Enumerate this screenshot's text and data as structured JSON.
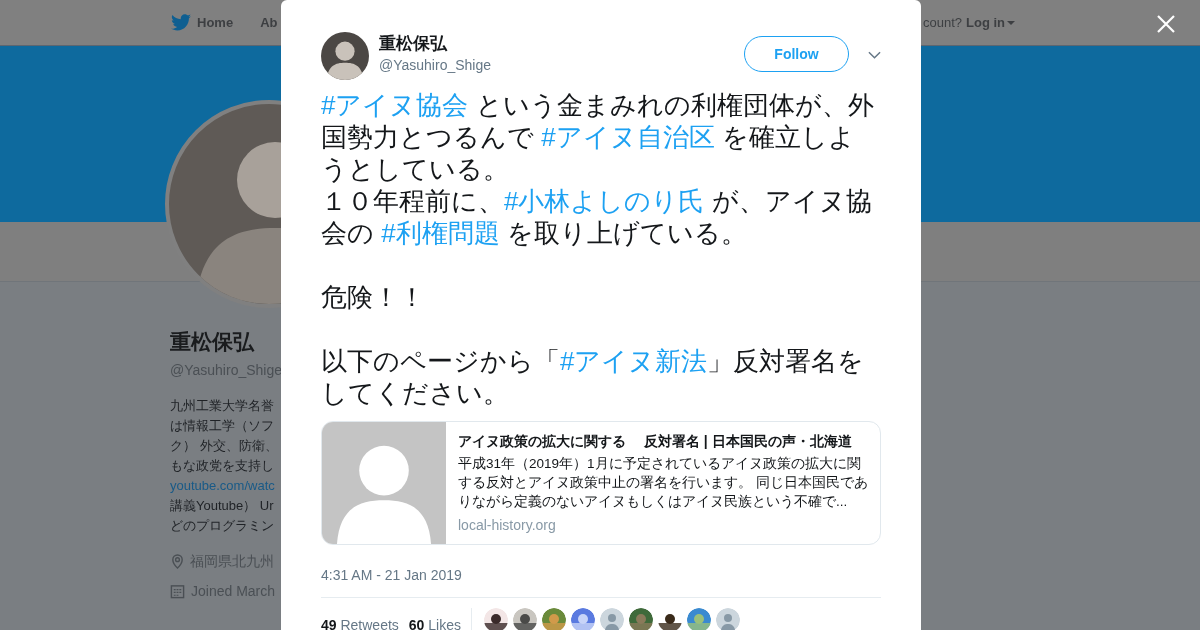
{
  "nav": {
    "items": [
      "Home",
      "Ab"
    ],
    "account_prompt": "count?",
    "login": "Log in"
  },
  "profile": {
    "name": "重松保弘",
    "handle": "@Yasuhiro_Shige",
    "bio_lines": [
      "九州工業大学名誉",
      "は情報工学（ソフ",
      "ク） 外交、防衛、",
      "もな政党を支持し",
      {
        "kind": "link",
        "text": "youtube.com/watc"
      },
      "講義Youtube） Ur",
      "どのプログラミン"
    ],
    "location": "福岡県北九州",
    "joined": "Joined March"
  },
  "tweet": {
    "author": {
      "name": "重松保弘",
      "handle": "@Yasuhiro_Shige"
    },
    "follow_label": "Follow",
    "sections": [
      [
        [
          {
            "kind": "hashtag",
            "text": "#アイヌ協会"
          },
          {
            "kind": "text",
            "text": " という金まみれの利権団体が、外国勢力とつるんで "
          },
          {
            "kind": "hashtag",
            "text": "#アイヌ自治区"
          },
          {
            "kind": "text",
            "text": " を確立しようとしている。"
          }
        ],
        [
          {
            "kind": "text",
            "text": "１０年程前に、"
          },
          {
            "kind": "hashtag",
            "text": "#小林よしのり氏"
          },
          {
            "kind": "text",
            "text": " が、アイヌ協会の "
          },
          {
            "kind": "hashtag",
            "text": "#利権問題"
          },
          {
            "kind": "text",
            "text": " を取り上げている。"
          }
        ]
      ],
      [
        [
          {
            "kind": "text",
            "text": "危険！！"
          }
        ]
      ],
      [
        [
          {
            "kind": "text",
            "text": "以下のページから「"
          },
          {
            "kind": "hashtag",
            "text": "#アイヌ新法"
          },
          {
            "kind": "text",
            "text": "」反対署名をしてください。"
          }
        ]
      ]
    ],
    "card": {
      "title": "アイヌ政策の拡大に関する　 反対署名 | 日本国民の声・北海道",
      "description": "平成31年（2019年）1月に予定されているアイヌ政策の拡大に関する反対とアイヌ政策中止の署名を行います。 同じ日本国民でありながら定義のないアイヌもしくはアイヌ民族という不確で...",
      "domain": "local-history.org"
    },
    "timestamp": "4:31 AM - 21 Jan 2019",
    "stats": [
      {
        "count": "49",
        "label": "Retweets"
      },
      {
        "count": "60",
        "label": "Likes"
      }
    ],
    "liker_avatars": [
      {
        "kind": "picture"
      },
      {
        "kind": "picture"
      },
      {
        "kind": "picture"
      },
      {
        "kind": "picture"
      },
      {
        "kind": "default"
      },
      {
        "kind": "picture"
      },
      {
        "kind": "picture"
      },
      {
        "kind": "picture"
      },
      {
        "kind": "default"
      }
    ]
  }
}
